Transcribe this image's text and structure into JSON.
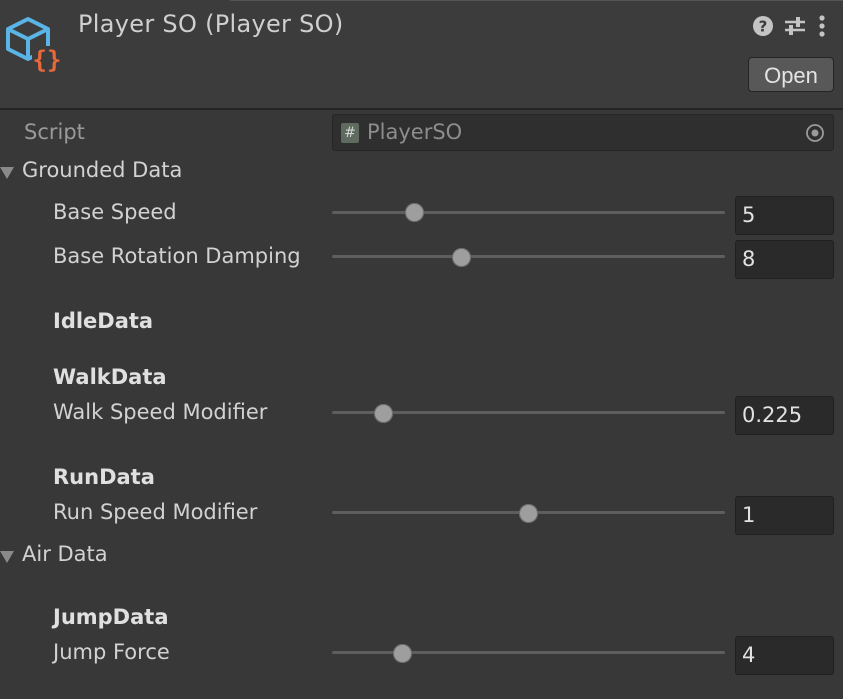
{
  "header": {
    "title": "Player SO (Player SO)",
    "open_label": "Open",
    "icons": [
      "scriptable-object-icon",
      "help-icon",
      "preset-icon",
      "more-options-icon"
    ]
  },
  "script": {
    "label": "Script",
    "value": "PlayerSO",
    "type_icon_glyph": "#"
  },
  "sections": {
    "grounded": {
      "label": "Grounded Data",
      "base_speed": {
        "label": "Base Speed",
        "value": "5",
        "fraction": 0.21
      },
      "base_rotation_damping": {
        "label": "Base Rotation Damping",
        "value": "8",
        "fraction": 0.33
      },
      "idle": {
        "header": "IdleData"
      },
      "walk": {
        "header": "WalkData",
        "walk_speed_modifier": {
          "label": "Walk Speed Modifier",
          "value": "0.225",
          "fraction": 0.13
        }
      },
      "run": {
        "header": "RunData",
        "run_speed_modifier": {
          "label": "Run Speed Modifier",
          "value": "1",
          "fraction": 0.5
        }
      }
    },
    "air": {
      "label": "Air Data",
      "jump": {
        "header": "JumpData",
        "jump_force": {
          "label": "Jump Force",
          "value": "4",
          "fraction": 0.18
        }
      }
    }
  },
  "colors": {
    "background": "#383838",
    "header_background": "#3c3c3c",
    "icon_blue": "#5ab4e6",
    "icon_orange": "#e8693a"
  }
}
